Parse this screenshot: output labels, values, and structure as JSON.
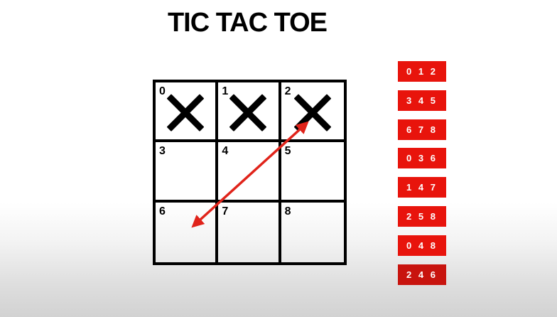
{
  "title": "TIC TAC TOE",
  "board": {
    "cells": [
      {
        "index": "0",
        "mark": "X"
      },
      {
        "index": "1",
        "mark": "X"
      },
      {
        "index": "2",
        "mark": "X"
      },
      {
        "index": "3",
        "mark": ""
      },
      {
        "index": "4",
        "mark": ""
      },
      {
        "index": "5",
        "mark": ""
      },
      {
        "index": "6",
        "mark": ""
      },
      {
        "index": "7",
        "mark": ""
      },
      {
        "index": "8",
        "mark": ""
      }
    ],
    "arrow": {
      "from_cell": "6",
      "to_cell": "2",
      "color": "#e0231a",
      "style": "double-headed"
    }
  },
  "combinations": [
    "0 1 2",
    "3 4 5",
    "6 7 8",
    "0 3 6",
    "1 4 7",
    "2 5 8",
    "0 4 8",
    "2 4 6"
  ],
  "colors": {
    "combo_bg": "#e8140c",
    "combo_active_bg": "#c8140e",
    "grid": "#000000",
    "mark": "#000000"
  }
}
